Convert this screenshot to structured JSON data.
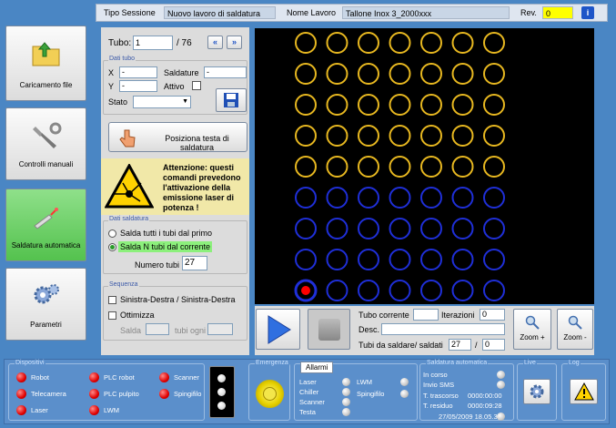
{
  "nav": [
    {
      "label": "Caricamento file",
      "icon": "folder-icon"
    },
    {
      "label": "Controlli manuali",
      "icon": "wrench-icon"
    },
    {
      "label": "Saldatura automatica",
      "icon": "laser-icon"
    },
    {
      "label": "Parametri",
      "icon": "gears-icon"
    }
  ],
  "header": {
    "tipo_label": "Tipo Sessione",
    "tipo_value": "Nuovo lavoro di saldatura",
    "nome_label": "Nome Lavoro",
    "nome_value": "Tallone Inox 3_2000xxx",
    "rev_label": "Rev.",
    "rev_value": "0"
  },
  "tubo": {
    "label": "Tubo:",
    "value": "1",
    "total": "/ 76"
  },
  "dati_tubo": {
    "title": "Dati tubo",
    "x_label": "X",
    "x_value": "-",
    "y_label": "Y",
    "y_value": "-",
    "saldature_label": "Saldature",
    "saldature_value": "-",
    "attivo_label": "Attivo",
    "stato_label": "Stato"
  },
  "posiziona_label": "Posiziona testa di saldatura",
  "warning": "Attenzione: questi comandi prevedono l'attivazione della emissione laser di potenza !",
  "dati_saldatura": {
    "title": "Dati saldatura",
    "opt1": "Salda tutti i tubi dal primo",
    "opt2": "Salda N tubi dal corrente",
    "numero_label": "Numero tubi",
    "numero_value": "27"
  },
  "sequenza": {
    "title": "Sequenza",
    "opt1": "Sinistra-Destra / Sinistra-Destra",
    "opt2": "Ottimizza",
    "salda_label": "Salda",
    "tubi_ogni_label": "tubi ogni"
  },
  "bottom": {
    "tubo_corrente_label": "Tubo corrente",
    "iterazioni_label": "Iterazioni",
    "iterazioni_value": "0",
    "desc_label": "Desc.",
    "tubi_da_saldare_label": "Tubi da saldare/ saldati",
    "tubi_da_saldare_value": "27",
    "slash": "/",
    "saldati_value": "0",
    "zoom_in_label": "Zoom +",
    "zoom_out_label": "Zoom -"
  },
  "grid": {
    "cols": 7,
    "rows": 9,
    "yellow_rows": 5,
    "colors": {
      "yellow": "#e8b820",
      "blue": "#1f2fd8",
      "current": "#ff0000"
    },
    "current_tube": {
      "row": 8,
      "col": 1
    }
  },
  "status": {
    "dispositivi_title": "Dispositivi",
    "devices": [
      "Robot",
      "PLC robot",
      "Scanner",
      "Telecamera",
      "PLC pulpito",
      "Spingifilo",
      "Laser",
      "LWM"
    ],
    "emergenza_title": "Emergenza",
    "allarmi_tab": "Allarmi",
    "allarmi_col1": [
      "Laser",
      "Chiller",
      "Scanner",
      "Testa"
    ],
    "allarmi_col2": [
      "LWM",
      "Spingifilo"
    ],
    "saldatura_title": "Saldatura automatica",
    "in_corso": "In corso",
    "invio_sms": "Invio SMS",
    "t_trascorso_label": "T. trascorso",
    "t_trascorso_value": "0000:00:00",
    "t_residuo_label": "T. residuo",
    "t_residuo_value": "0000:09:28",
    "datetime": "27/05/2009 18.05.31",
    "live_title": "Live",
    "log_title": "Log"
  }
}
